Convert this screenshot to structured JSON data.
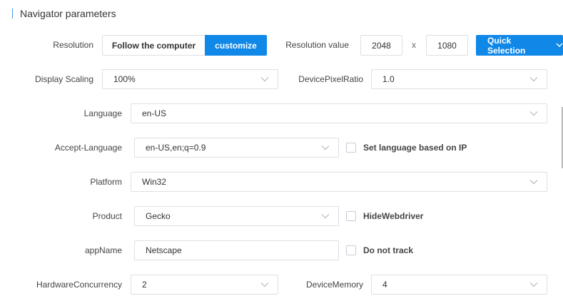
{
  "section": {
    "title": "Navigator parameters"
  },
  "resolution": {
    "label": "Resolution",
    "option_follow": "Follow the computer",
    "option_customize": "customize",
    "value_label": "Resolution value",
    "width": "2048",
    "separator": "x",
    "height": "1080",
    "quick_selection": "Quick Selection"
  },
  "display_scaling": {
    "label": "Display Scaling",
    "value": "100%"
  },
  "device_pixel_ratio": {
    "label": "DevicePixelRatio",
    "value": "1.0"
  },
  "language": {
    "label": "Language",
    "value": "en-US"
  },
  "accept_language": {
    "label": "Accept-Language",
    "value": "en-US,en;q=0.9",
    "checkbox": "Set language based on IP"
  },
  "platform": {
    "label": "Platform",
    "value": "Win32"
  },
  "product": {
    "label": "Product",
    "value": "Gecko",
    "checkbox": "HideWebdriver"
  },
  "app_name": {
    "label": "appName",
    "value": "Netscape",
    "checkbox": "Do not track"
  },
  "hardware_concurrency": {
    "label": "HardwareConcurrency",
    "value": "2"
  },
  "device_memory": {
    "label": "DeviceMemory",
    "value": "4"
  },
  "colors": {
    "accent": "#1088e8",
    "border": "#dcdfe6"
  }
}
